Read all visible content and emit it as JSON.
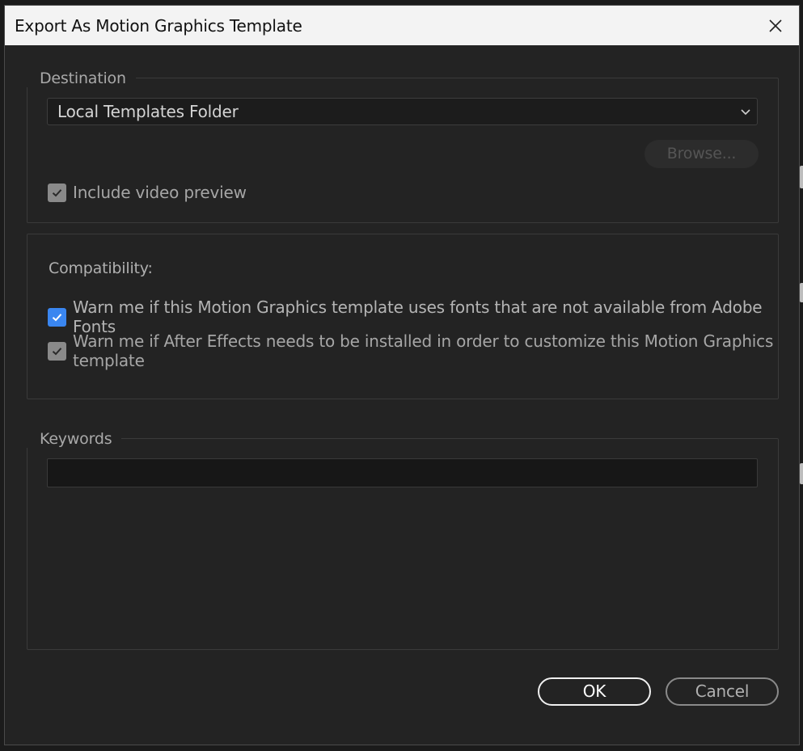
{
  "window": {
    "title": "Export As Motion Graphics Template",
    "close_icon": "close-icon"
  },
  "destination": {
    "legend": "Destination",
    "select_value": "Local Templates Folder",
    "browse_label": "Browse...",
    "include_preview": {
      "label": "Include video preview",
      "checked": true,
      "disabled": true
    }
  },
  "compatibility": {
    "label": "Compatibility:",
    "options": [
      {
        "label": "Warn me if this Motion Graphics template uses fonts that are not available from Adobe Fonts",
        "checked": true,
        "disabled": false
      },
      {
        "label": "Warn me if After Effects needs to be installed in order to customize this Motion Graphics template",
        "checked": true,
        "disabled": true
      }
    ]
  },
  "keywords": {
    "legend": "Keywords",
    "value": "",
    "placeholder": ""
  },
  "buttons": {
    "ok": "OK",
    "cancel": "Cancel"
  },
  "colors": {
    "accent": "#3a86f0",
    "dialog_bg": "#232323",
    "titlebar_bg": "#f3f3f3"
  }
}
